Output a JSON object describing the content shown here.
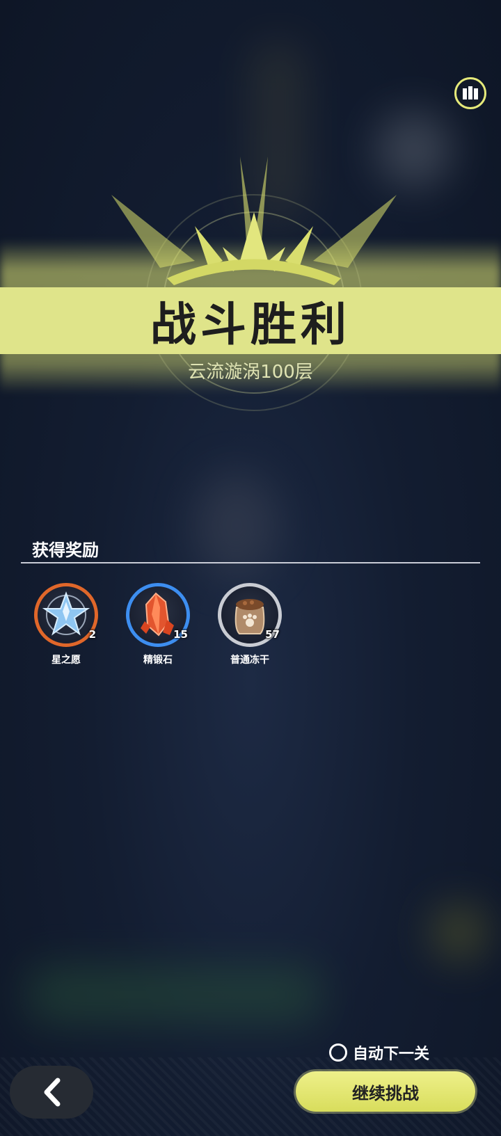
{
  "banner": {
    "title": "战斗胜利",
    "subtitle": "云流漩涡100层"
  },
  "rewards": {
    "section_label": "获得奖励",
    "items": [
      {
        "name": "星之愿",
        "count": "2",
        "icon": "star-crystal-icon",
        "ring_color": "#e0672a"
      },
      {
        "name": "精锻石",
        "count": "15",
        "icon": "red-crystal-icon",
        "ring_color": "#3d8ef0"
      },
      {
        "name": "普通冻干",
        "count": "57",
        "icon": "food-sack-icon",
        "ring_color": "#c9ccd3"
      }
    ]
  },
  "footer": {
    "auto_next_label": "自动下一关",
    "continue_label": "继续挑战"
  },
  "colors": {
    "accent": "#dfe48a",
    "background": "#131d31"
  }
}
